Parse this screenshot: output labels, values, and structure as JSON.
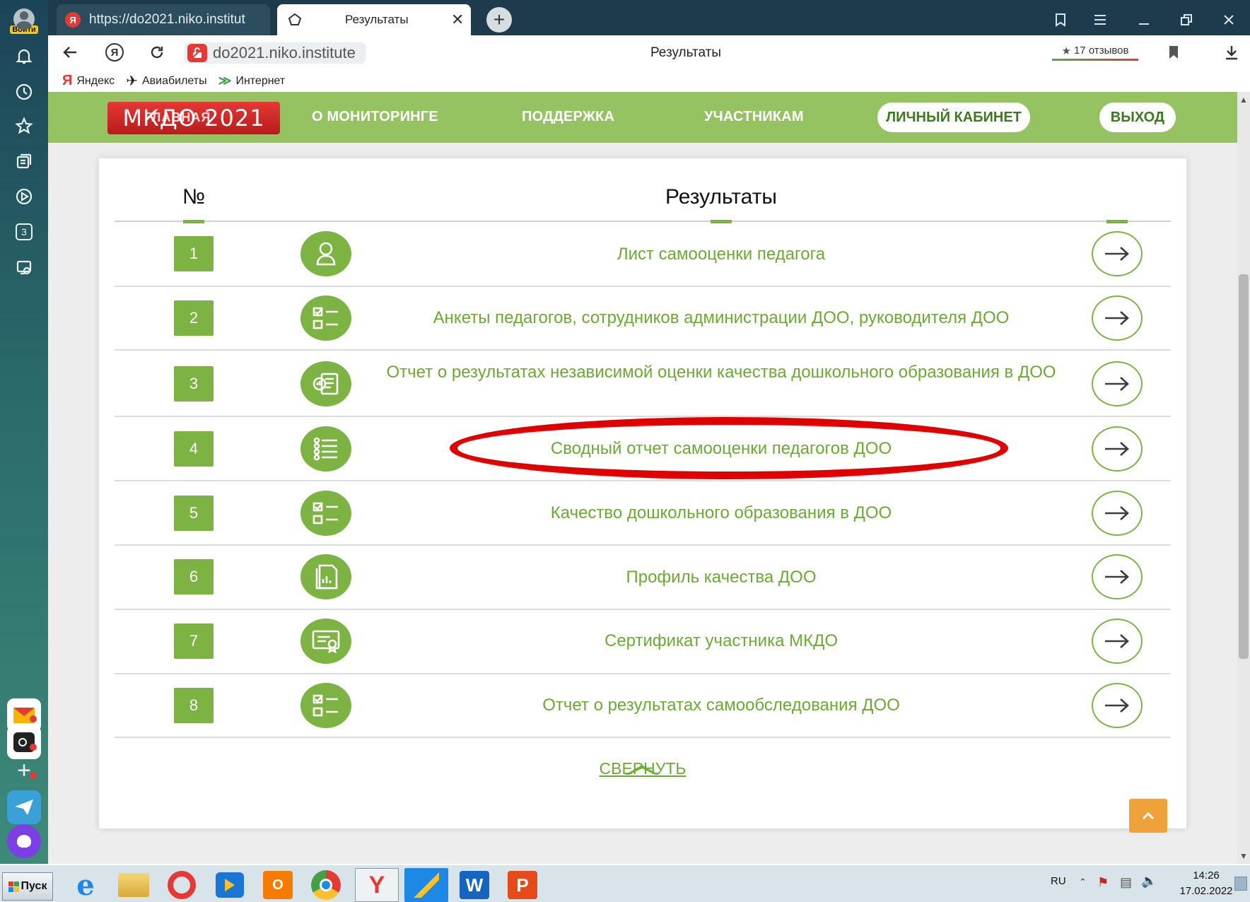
{
  "sidebar": {
    "login_label": "Войти",
    "icons": [
      "bell-icon",
      "history-icon",
      "star-icon",
      "collections-icon",
      "play-icon",
      "tabs-counter-icon",
      "screenshot-icon"
    ],
    "tabs_counter": "3",
    "apps": [
      "mail-app",
      "alice-app",
      "add-app",
      "messenger-app",
      "alice-purple-app"
    ]
  },
  "browser": {
    "tab1_title": "https://do2021.niko.institut",
    "tab2_title": "Результаты",
    "address": "do2021.niko.institute",
    "page_title": "Результаты",
    "reviews": "17 отзывов",
    "bookmarks": [
      "Яндекс",
      "Авиабилеты",
      "Интернет"
    ]
  },
  "site": {
    "logo_text": "МКДО 2021",
    "logo_overlay": "ГЛАВНАЯ",
    "nav": [
      "О МОНИТОРИНГЕ",
      "ПОДДЕРЖКА",
      "УЧАСТНИКАМ"
    ],
    "cabinet_label": "ЛИЧНЫЙ КАБИНЕТ",
    "logout_label": "ВЫХОД"
  },
  "table": {
    "col_num": "№",
    "col_results": "Результаты",
    "rows": [
      {
        "num": "1",
        "icon": "user-icon",
        "label": "Лист самооценки педагога"
      },
      {
        "num": "2",
        "icon": "checklist-icon",
        "label": "Анкеты педагогов, сотрудников администрации ДОО, руководителя ДОО"
      },
      {
        "num": "3",
        "icon": "report-chat-icon",
        "label": "Отчет о результатах независимой оценки качества дошкольного образования в ДОО"
      },
      {
        "num": "4",
        "icon": "list-icon",
        "label": "Сводный отчет самооценки педагогов ДОО"
      },
      {
        "num": "5",
        "icon": "checklist-icon",
        "label": "Качество дошкольного образования в ДОО"
      },
      {
        "num": "6",
        "icon": "document-chart-icon",
        "label": "Профиль качества ДОО"
      },
      {
        "num": "7",
        "icon": "certificate-icon",
        "label": "Сертификат участника МКДО"
      },
      {
        "num": "8",
        "icon": "checklist-icon",
        "label": "Отчет о результатах самообследования ДОО"
      }
    ],
    "collapse_label": "СВЕРНУТЬ"
  },
  "taskbar": {
    "start_label": "Пуск",
    "lang": "RU",
    "time": "14:26",
    "date": "17.02.2022"
  },
  "colors": {
    "accent_green": "#7cb342",
    "nav_green": "#95c361",
    "logo_red": "#d32f2f",
    "highlight_red": "#e00000"
  }
}
